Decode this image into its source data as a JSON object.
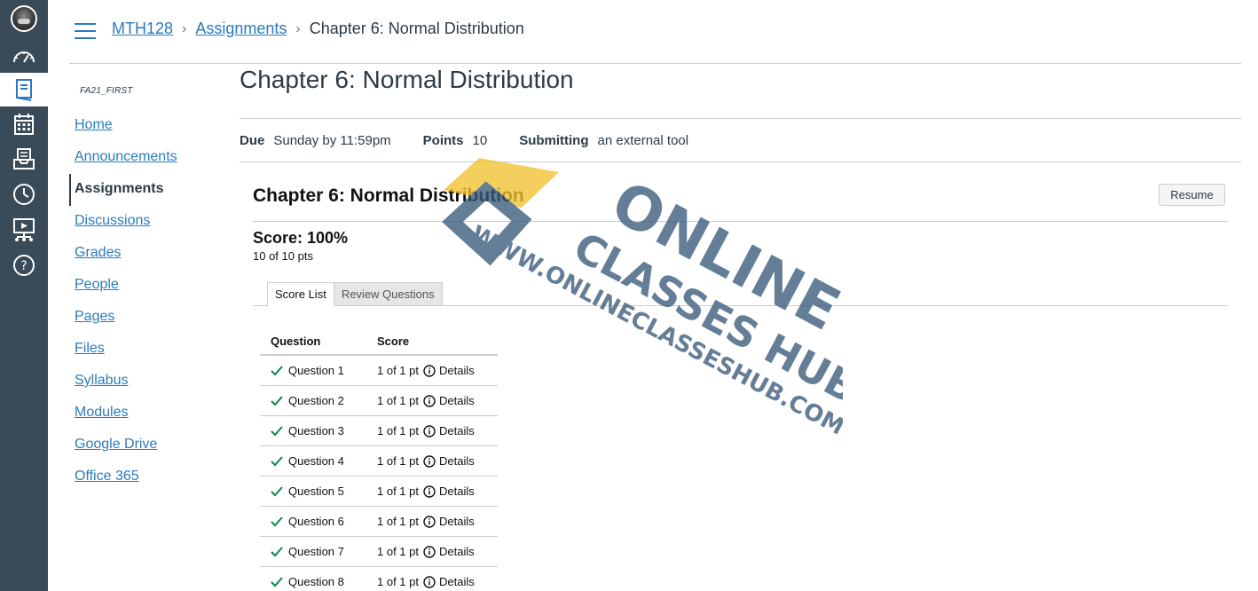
{
  "global_nav": {
    "items": [
      {
        "name": "account",
        "icon": "avatar-icon"
      },
      {
        "name": "dashboard",
        "icon": "dashboard-icon"
      },
      {
        "name": "courses",
        "icon": "courses-icon"
      },
      {
        "name": "calendar",
        "icon": "calendar-icon"
      },
      {
        "name": "inbox",
        "icon": "inbox-icon"
      },
      {
        "name": "history",
        "icon": "clock-icon"
      },
      {
        "name": "commons",
        "icon": "commons-icon"
      },
      {
        "name": "help",
        "icon": "help-icon"
      }
    ],
    "bg_color": "#394b58"
  },
  "breadcrumb": {
    "course": "MTH128",
    "section": "Assignments",
    "current": "Chapter 6: Normal Distribution"
  },
  "course_nav": {
    "term": "FA21_FIRST",
    "links": [
      "Home",
      "Announcements",
      "Assignments",
      "Discussions",
      "Grades",
      "People",
      "Pages",
      "Files",
      "Syllabus",
      "Modules",
      "Google Drive",
      "Office 365"
    ],
    "active": "Assignments"
  },
  "assignment": {
    "title": "Chapter 6: Normal Distribution",
    "due_label": "Due",
    "due_value": "Sunday by 11:59pm",
    "points_label": "Points",
    "points_value": "10",
    "submitting_label": "Submitting",
    "submitting_value": "an external tool"
  },
  "tool": {
    "title": "Chapter 6: Normal Distribution",
    "resume_label": "Resume",
    "score": "Score: 100%",
    "score_detail": "10 of 10 pts",
    "tabs": [
      "Score List",
      "Review Questions"
    ],
    "active_tab": "Score List",
    "table": {
      "headers": [
        "Question",
        "Score"
      ],
      "rows": [
        {
          "question": "Question 1",
          "score": "1 of 1 pt",
          "details": "Details"
        },
        {
          "question": "Question 2",
          "score": "1 of 1 pt",
          "details": "Details"
        },
        {
          "question": "Question 3",
          "score": "1 of 1 pt",
          "details": "Details"
        },
        {
          "question": "Question 4",
          "score": "1 of 1 pt",
          "details": "Details"
        },
        {
          "question": "Question 5",
          "score": "1 of 1 pt",
          "details": "Details"
        },
        {
          "question": "Question 6",
          "score": "1 of 1 pt",
          "details": "Details"
        },
        {
          "question": "Question 7",
          "score": "1 of 1 pt",
          "details": "Details"
        },
        {
          "question": "Question 8",
          "score": "1 of 1 pt",
          "details": "Details"
        }
      ]
    }
  },
  "watermark": {
    "brand_line1": "ONLINE",
    "brand_line2": "CLASSES HUB",
    "url": "WWW.ONLINECLASSESHUB.COM"
  },
  "colors": {
    "link": "#2b7abc",
    "text": "#2d3b45",
    "check": "#0b874b",
    "watermark_blue": "#3a5a7a",
    "watermark_yellow": "#f2c230"
  }
}
